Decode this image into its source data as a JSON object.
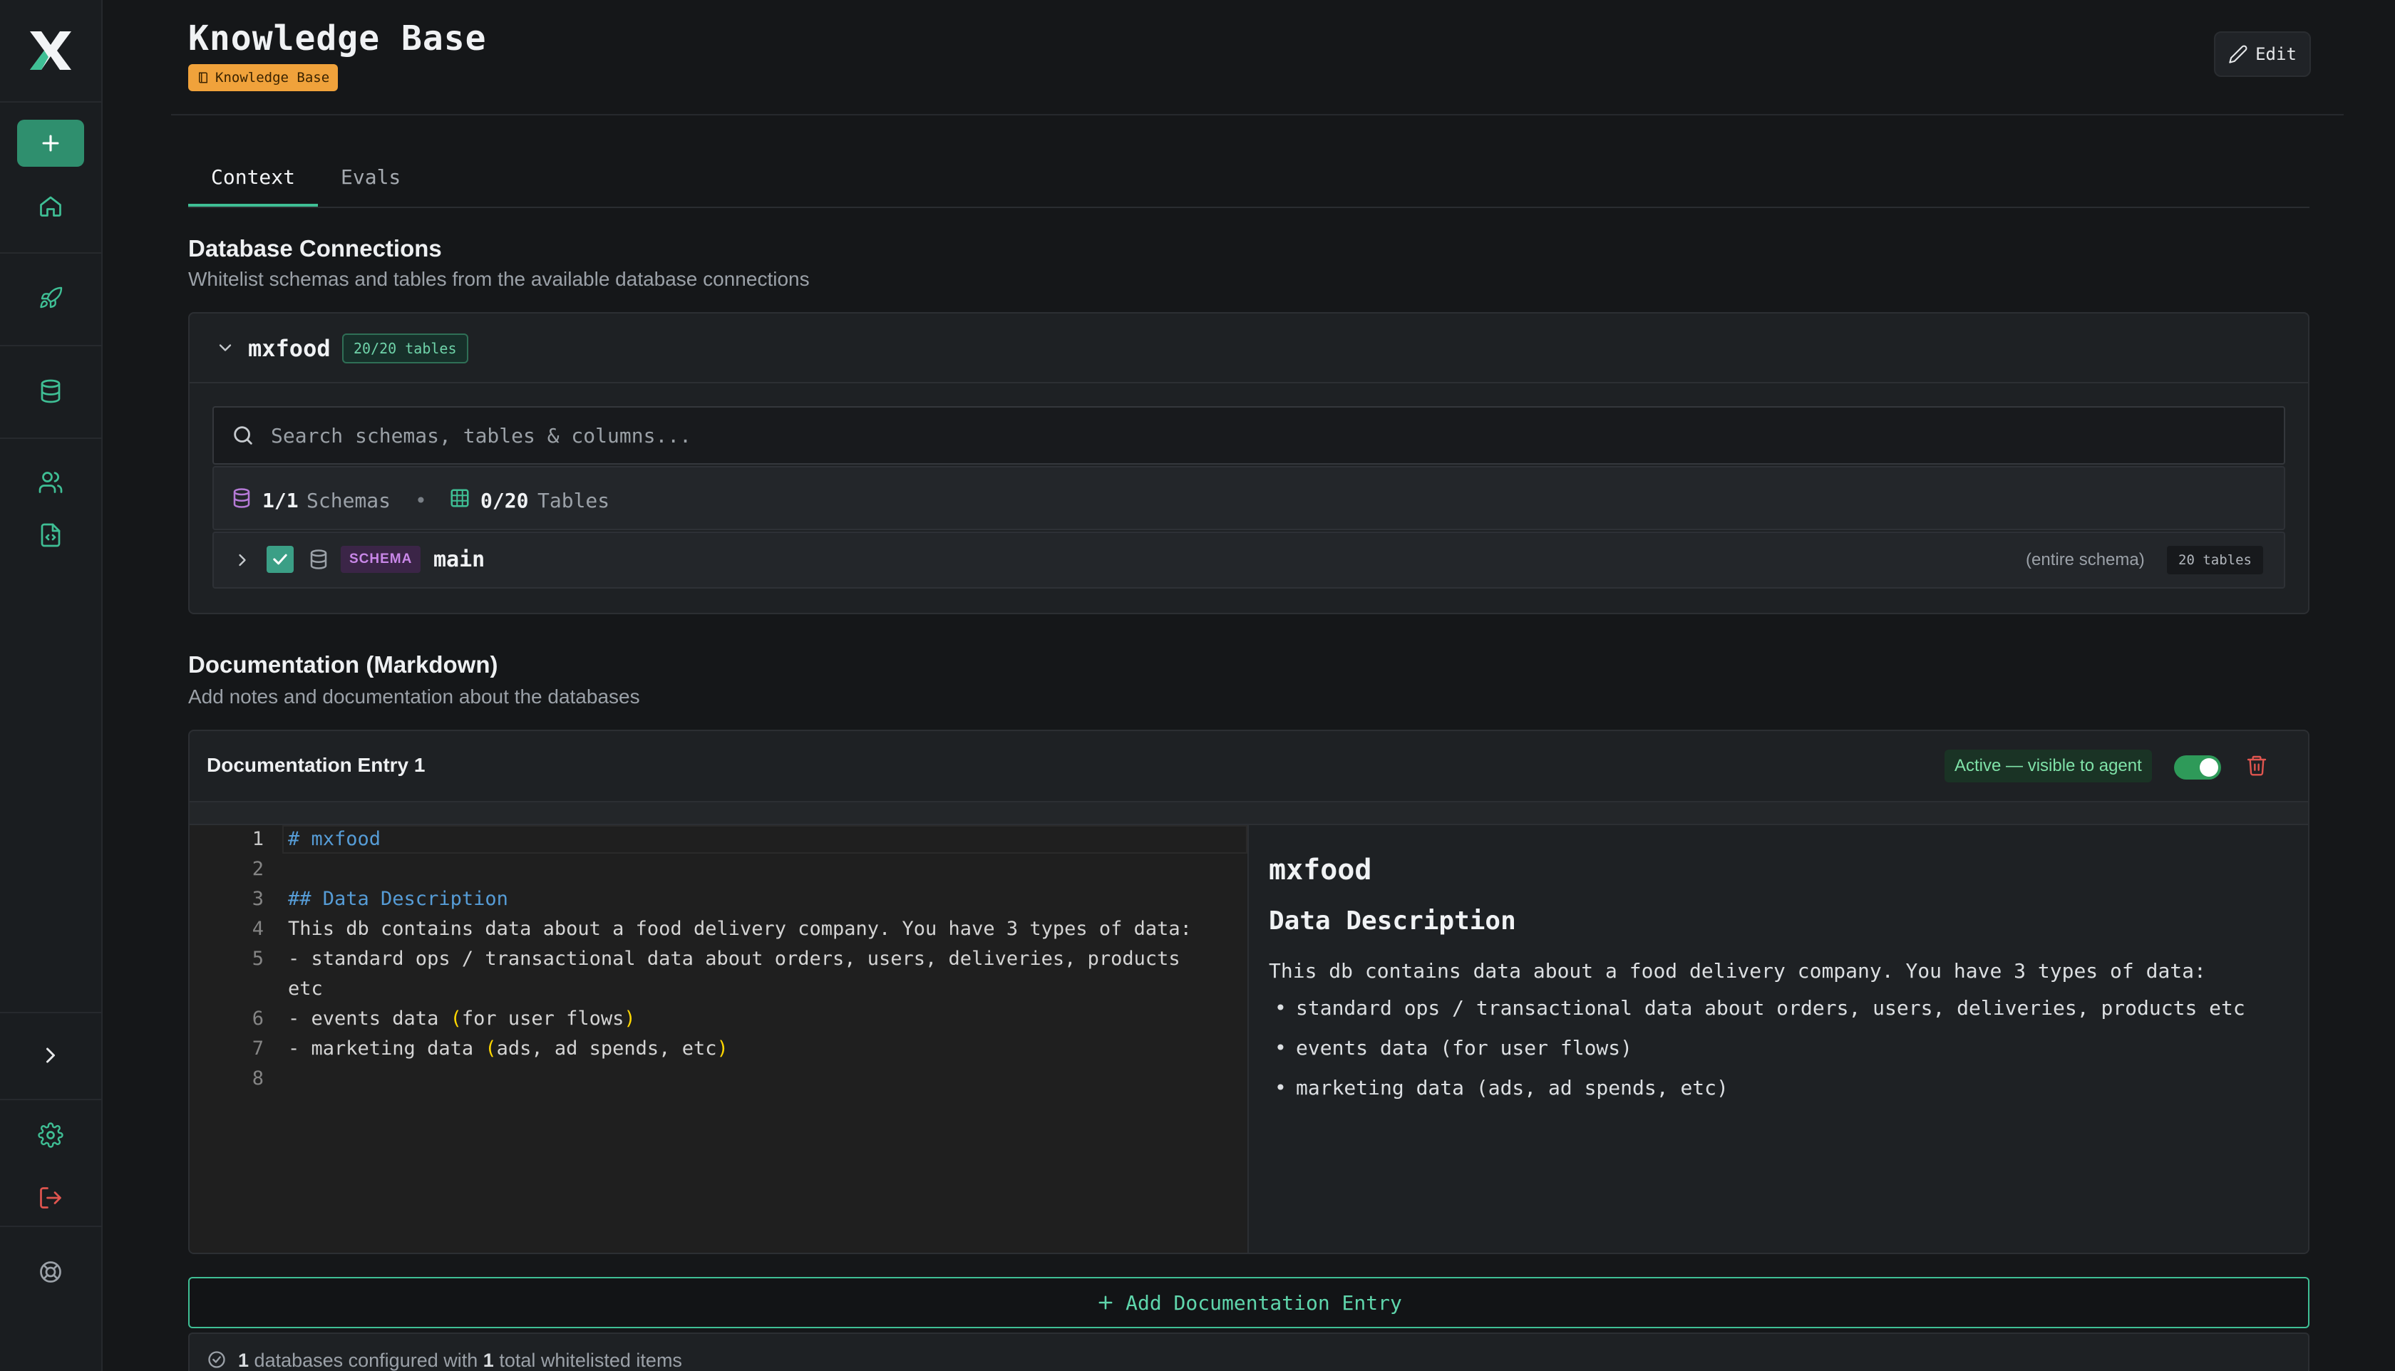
{
  "header": {
    "title": "Knowledge Base",
    "badge": "Knowledge Base",
    "edit_label": "Edit"
  },
  "tabs": [
    {
      "label": "Context",
      "active": true
    },
    {
      "label": "Evals",
      "active": false
    }
  ],
  "db_section": {
    "title": "Database Connections",
    "subtitle": "Whitelist schemas and tables from the available database connections",
    "connection": {
      "name": "mxfood",
      "tables_badge": "20/20 tables",
      "search_placeholder": "Search schemas, tables & columns...",
      "schemas_count": "1/1",
      "schemas_label": "Schemas",
      "tables_count": "0/20",
      "tables_label": "Tables",
      "schema_row": {
        "tag": "SCHEMA",
        "name": "main",
        "checked": true,
        "scope": "(entire schema)",
        "tables": "20 tables"
      }
    }
  },
  "doc_section": {
    "title": "Documentation (Markdown)",
    "subtitle": "Add notes and documentation about the databases",
    "entry": {
      "title": "Documentation Entry 1",
      "status": "Active — visible to agent",
      "enabled": true,
      "lines": [
        {
          "no": "1",
          "text": "# mxfood"
        },
        {
          "no": "2",
          "text": ""
        },
        {
          "no": "3",
          "text": "## Data Description"
        },
        {
          "no": "4",
          "text": "This db contains data about a food delivery company. You have 3 types of data:"
        },
        {
          "no": "5",
          "text": "- standard ops / transactional data about orders, users, deliveries, products"
        },
        {
          "no": "",
          "text": "etc"
        },
        {
          "no": "6",
          "text": "- events data (for user flows)"
        },
        {
          "no": "7",
          "text": "- marketing data (ads, ad spends, etc)"
        },
        {
          "no": "8",
          "text": ""
        }
      ],
      "preview": {
        "h1": "mxfood",
        "h2": "Data Description",
        "paragraph": "This db contains data about a food delivery company. You have 3 types of data:",
        "items": [
          "standard ops / transactional data about orders, users, deliveries, products etc",
          "events data (for user flows)",
          "marketing data (ads, ad spends, etc)"
        ]
      }
    },
    "add_label": "Add Documentation Entry"
  },
  "footer": {
    "db_count": "1",
    "text_a": "databases configured with",
    "items_count": "1",
    "text_b": "total whitelisted items"
  },
  "colors": {
    "accent": "#3fbf95",
    "badge_orange": "#f0a23b",
    "danger": "#e0554f"
  },
  "sidebar_icons": [
    "logo-icon",
    "plus-icon",
    "home-icon",
    "rocket-icon",
    "database-icon",
    "users-icon",
    "file-code-icon",
    "chevron-right-icon",
    "gear-icon",
    "logout-icon",
    "lifebuoy-icon"
  ]
}
